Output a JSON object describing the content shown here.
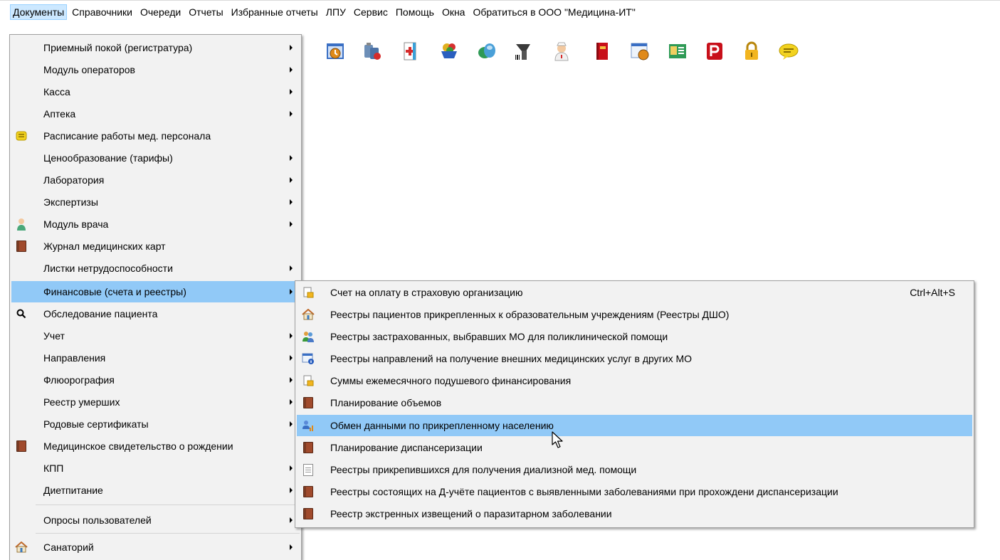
{
  "menubar": {
    "items": [
      "Документы",
      "Справочники",
      "Очереди",
      "Отчеты",
      "Избранные отчеты",
      "ЛПУ",
      "Сервис",
      "Помощь",
      "Окна",
      "Обратиться в ООО \"Медицина-ИТ\""
    ]
  },
  "toolbar": {
    "icons": [
      "schedule-icon",
      "medicine-icon",
      "medical-card-icon",
      "basket-icon",
      "pills-icon",
      "barcode-scanner-icon",
      "nurse-icon",
      "red-book-icon",
      "timetable-icon",
      "id-card-icon",
      "pdf-icon",
      "lock-icon",
      "message-icon"
    ]
  },
  "documents_menu": {
    "items": [
      {
        "label": "Приемный покой (регистратура)",
        "submenu": true,
        "icon": ""
      },
      {
        "label": "Модуль операторов",
        "submenu": true,
        "icon": ""
      },
      {
        "label": "Касса",
        "submenu": true,
        "icon": ""
      },
      {
        "label": "Аптека",
        "submenu": true,
        "icon": ""
      },
      {
        "label": "Расписание работы мед. персонала",
        "submenu": false,
        "icon": "message-icon"
      },
      {
        "label": "Ценообразование (тарифы)",
        "submenu": true,
        "icon": ""
      },
      {
        "label": "Лаборатория",
        "submenu": true,
        "icon": ""
      },
      {
        "label": "Экспертизы",
        "submenu": true,
        "icon": ""
      },
      {
        "label": "Модуль врача",
        "submenu": true,
        "icon": "doctor-icon"
      },
      {
        "label": "Журнал медицинских карт",
        "submenu": false,
        "icon": "book-icon"
      },
      {
        "label": "Листки нетрудоспособности",
        "submenu": true,
        "icon": ""
      },
      {
        "label": "Финансовые (счета и реестры)",
        "submenu": true,
        "icon": "",
        "highlighted": true
      },
      {
        "label": "Обследование пациента",
        "submenu": false,
        "icon": "search-icon"
      },
      {
        "label": "Учет",
        "submenu": true,
        "icon": ""
      },
      {
        "label": "Направления",
        "submenu": true,
        "icon": ""
      },
      {
        "label": "Флюорография",
        "submenu": true,
        "icon": ""
      },
      {
        "label": "Реестр умерших",
        "submenu": true,
        "icon": ""
      },
      {
        "label": "Родовые сертификаты",
        "submenu": true,
        "icon": ""
      },
      {
        "label": "Медицинское свидетельство о рождении",
        "submenu": false,
        "icon": "book-icon"
      },
      {
        "label": "КПП",
        "submenu": true,
        "icon": ""
      },
      {
        "label": "Диетпитание",
        "submenu": true,
        "icon": ""
      },
      {
        "label": "Опросы пользователей",
        "submenu": true,
        "icon": ""
      },
      {
        "label": "Санаторий",
        "submenu": true,
        "icon": "house-icon"
      }
    ]
  },
  "financial_submenu": {
    "items": [
      {
        "label": "Счет на оплату в страховую организацию",
        "shortcut": "Ctrl+Alt+S",
        "icon": "document-folder-icon"
      },
      {
        "label": "Реестры пациентов прикрепленных к образовательным учреждениям (Реестры ДШО)",
        "shortcut": "",
        "icon": "house-icon"
      },
      {
        "label": "Реестры застрахованных, выбравших МО для поликлинической помощи",
        "shortcut": "",
        "icon": "people-icon"
      },
      {
        "label": "Реестры направлений на получение внешних медицинских услуг в других МО",
        "shortcut": "",
        "icon": "form-info-icon"
      },
      {
        "label": "Суммы ежемесячного подушевого финансирования",
        "shortcut": "",
        "icon": "document-folder-icon"
      },
      {
        "label": "Планирование объемов",
        "shortcut": "",
        "icon": "book-icon"
      },
      {
        "label": "Обмен данными по прикрепленному населению",
        "shortcut": "",
        "icon": "user-chart-icon",
        "highlighted": true
      },
      {
        "label": "Планирование диспансеризации",
        "shortcut": "",
        "icon": "book-icon"
      },
      {
        "label": "Реестры прикрепившихся для получения диализной мед. помощи",
        "shortcut": "",
        "icon": "document-icon"
      },
      {
        "label": "Реестры состоящих на Д-учёте пациентов с выявленными заболеваниями при прохождени диспансеризации",
        "shortcut": "",
        "icon": "book-icon"
      },
      {
        "label": "Реестр экстренных извещений о паразитарном заболевании",
        "shortcut": "",
        "icon": "book-icon"
      }
    ]
  }
}
